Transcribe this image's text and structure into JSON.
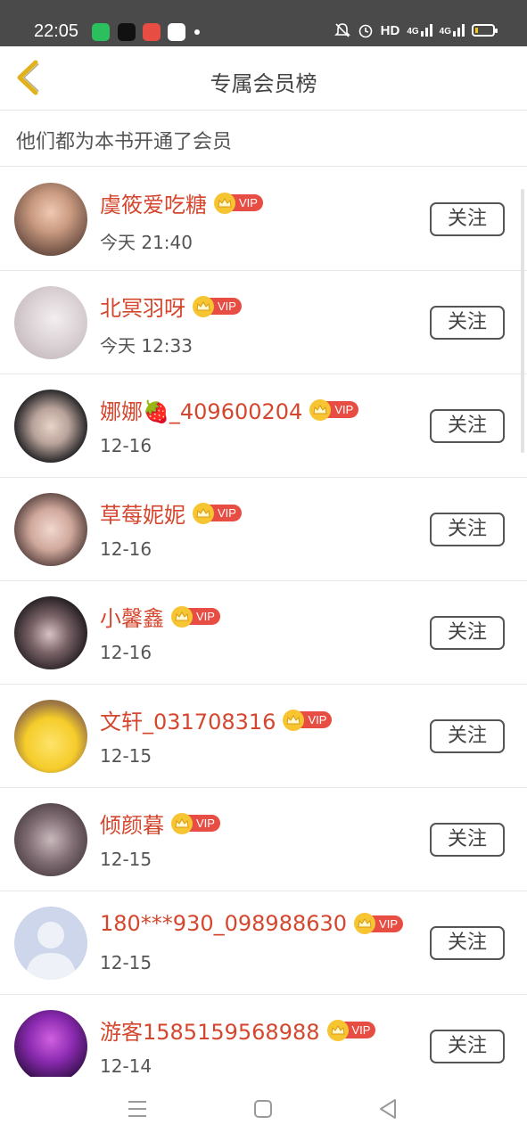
{
  "status_bar": {
    "time": "22:05",
    "network": "HD",
    "signal_1": "4G",
    "signal_2": "4G",
    "icons": [
      "notification-muted-icon",
      "alarm-icon",
      "signal-icon",
      "battery-icon"
    ]
  },
  "header": {
    "title": "专属会员榜",
    "back_icon": "chevron-left-icon"
  },
  "notice": "他们都为本书开通了会员",
  "colors": {
    "name_color": "#d4472e",
    "vip_tag": "#e84d43",
    "crown": "#f7c531",
    "back_arrow": "#e0b21c"
  },
  "vip_label": "VIP",
  "members": [
    {
      "name": "虞筱爱吃糖",
      "date": "今天 21:40",
      "follow": "关注"
    },
    {
      "name": "北冥羽呀",
      "date": "今天 12:33",
      "follow": "关注"
    },
    {
      "name": "娜娜🍓_409600204",
      "date": "12-16",
      "follow": "关注"
    },
    {
      "name": "草莓妮妮",
      "date": "12-16",
      "follow": "关注"
    },
    {
      "name": "小馨鑫",
      "date": "12-16",
      "follow": "关注"
    },
    {
      "name": "文轩_031708316",
      "date": "12-15",
      "follow": "关注"
    },
    {
      "name": "倾颜暮",
      "date": "12-15",
      "follow": "关注"
    },
    {
      "name": "180***930_098988630",
      "date": "12-15",
      "follow": "关注"
    },
    {
      "name": "游客1585159568988",
      "date": "12-14",
      "follow": "关注"
    }
  ],
  "nav_bar": [
    "menu-icon",
    "home-icon",
    "back-icon"
  ]
}
